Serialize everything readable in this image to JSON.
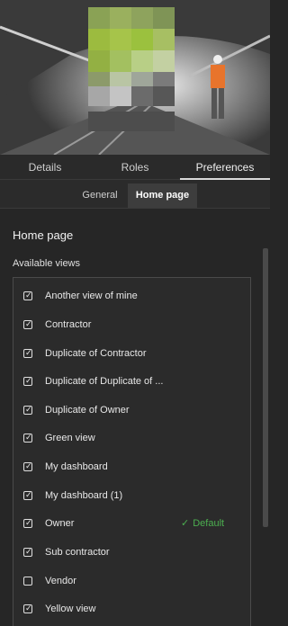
{
  "tabs": [
    "Details",
    "Roles",
    "Preferences"
  ],
  "active_tab": "Preferences",
  "subtabs": {
    "general": "General",
    "home_page": "Home page"
  },
  "section_title": "Home page",
  "views_label": "Available views",
  "default_label": "Default",
  "views": [
    {
      "label": "Another view of mine",
      "checked": true
    },
    {
      "label": "Contractor",
      "checked": true
    },
    {
      "label": "Duplicate of Contractor",
      "checked": true
    },
    {
      "label": "Duplicate of Duplicate of ...",
      "checked": true
    },
    {
      "label": "Duplicate of Owner",
      "checked": true
    },
    {
      "label": "Green view",
      "checked": true
    },
    {
      "label": "My dashboard",
      "checked": true
    },
    {
      "label": "My dashboard (1)",
      "checked": true
    },
    {
      "label": "Owner",
      "checked": true,
      "default": true
    },
    {
      "label": "Sub contractor",
      "checked": true
    },
    {
      "label": "Vendor",
      "checked": false
    },
    {
      "label": "Yellow view",
      "checked": true
    }
  ],
  "colors": {
    "accent_green": "#4caf50",
    "background": "#262626"
  }
}
